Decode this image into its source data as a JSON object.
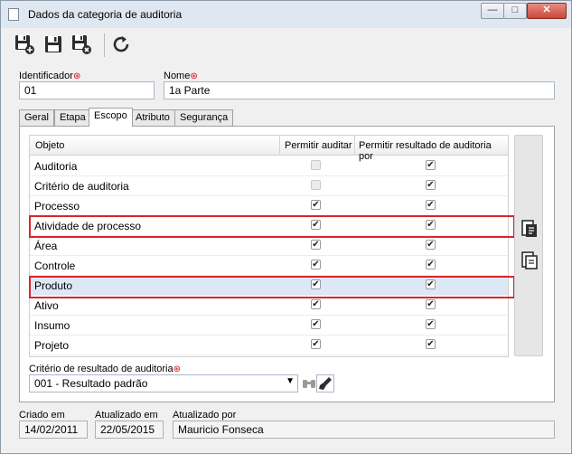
{
  "window": {
    "title": "Dados da categoria de auditoria",
    "min": "—",
    "max": "□",
    "close": "✕"
  },
  "toolbar": {
    "save_new": "save-new",
    "save": "save",
    "save_close": "save-close",
    "refresh": "refresh"
  },
  "fields": {
    "identificador_label": "Identificador",
    "identificador_value": "01",
    "nome_label": "Nome",
    "nome_value": "1a Parte",
    "required_mark": "⊛"
  },
  "tabs": [
    "Geral",
    "Etapa",
    "Escopo",
    "Atributo",
    "Segurança"
  ],
  "active_tab": "Escopo",
  "grid": {
    "columns": [
      "Objeto",
      "Permitir auditar",
      "Permitir resultado de auditoria por"
    ],
    "rows": [
      {
        "name": "Auditoria",
        "auditar": false,
        "auditar_disabled": true,
        "resultado": true
      },
      {
        "name": "Critério de auditoria",
        "auditar": false,
        "auditar_disabled": true,
        "resultado": true
      },
      {
        "name": "Processo",
        "auditar": true,
        "auditar_disabled": false,
        "resultado": true
      },
      {
        "name": "Atividade de processo",
        "auditar": true,
        "auditar_disabled": false,
        "resultado": true,
        "highlighted": true
      },
      {
        "name": "Área",
        "auditar": true,
        "auditar_disabled": false,
        "resultado": true
      },
      {
        "name": "Controle",
        "auditar": true,
        "auditar_disabled": false,
        "resultado": true
      },
      {
        "name": "Produto",
        "auditar": true,
        "auditar_disabled": false,
        "resultado": true,
        "highlighted": true,
        "selected": true
      },
      {
        "name": "Ativo",
        "auditar": true,
        "auditar_disabled": false,
        "resultado": true
      },
      {
        "name": "Insumo",
        "auditar": true,
        "auditar_disabled": false,
        "resultado": true
      },
      {
        "name": "Projeto",
        "auditar": true,
        "auditar_disabled": false,
        "resultado": true
      }
    ],
    "check_glyph": "✔"
  },
  "criterio": {
    "label": "Critério de resultado de auditoria",
    "value": "001 - Resultado padrão",
    "arrow": "▼"
  },
  "footer": {
    "criado_label": "Criado em",
    "criado_value": "14/02/2011",
    "atualizado_em_label": "Atualizado em",
    "atualizado_em_value": "22/05/2015",
    "atualizado_por_label": "Atualizado por",
    "atualizado_por_value": "Mauricio Fonseca"
  },
  "colors": {
    "highlight": "#d9262c",
    "selected_row": "#dde8f6",
    "titlebar": "#dfe7f0"
  }
}
